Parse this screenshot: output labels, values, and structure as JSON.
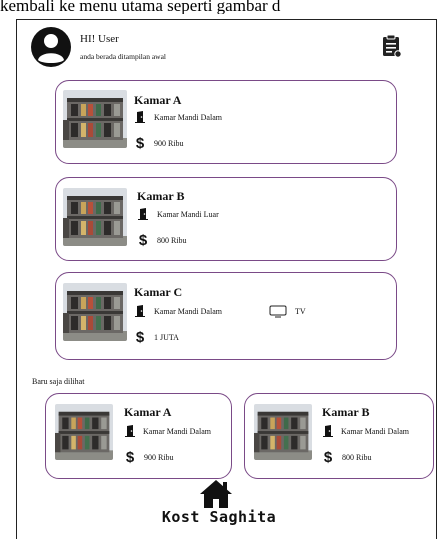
{
  "caption": "kembali ke menu utama seperti gambar d",
  "header": {
    "greeting": "HI! User",
    "subtitle": "anda berada ditampilan awal"
  },
  "rooms": [
    {
      "name": "Kamar A",
      "bathroom": "Kamar Mandi Dalam",
      "price": "900 Ribu",
      "extra": ""
    },
    {
      "name": "Kamar B",
      "bathroom": "Kamar Mandi Luar",
      "price": "800 Ribu",
      "extra": ""
    },
    {
      "name": "Kamar C",
      "bathroom": "Kamar Mandi Dalam",
      "price": "1 JUTA",
      "extra": "TV"
    }
  ],
  "recent": {
    "label": "Baru saja dilihat",
    "items": [
      {
        "name": "Kamar A",
        "bathroom": "Kamar Mandi Dalam",
        "price": "900 Ribu"
      },
      {
        "name": "Kamar B",
        "bathroom": "Kamar Mandi Dalam",
        "price": "800 Ribu"
      }
    ]
  },
  "footer": {
    "brand": "Kost Saghita"
  },
  "icons": {
    "avatar": "user-circle-icon",
    "clipboard": "clipboard-icon",
    "bath": "door-icon",
    "price": "dollar-icon",
    "tv": "tv-icon",
    "home": "home-icon"
  },
  "colors": {
    "card_border": "#7a4a87"
  }
}
